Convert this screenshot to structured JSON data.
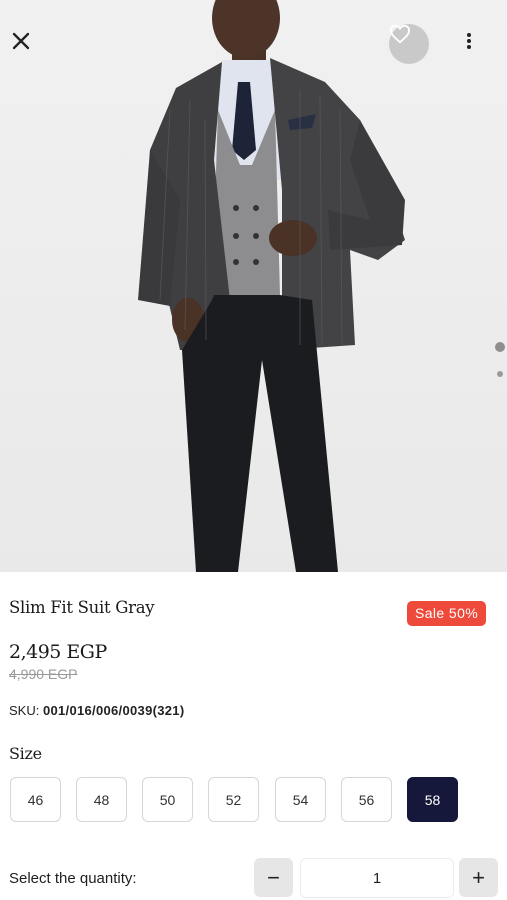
{
  "product": {
    "title": "Slim Fit Suit Gray",
    "badge": "Sale 50%",
    "price": "2,495 EGP",
    "old_price": "4,990 EGP",
    "sku_label": "SKU:",
    "sku_value": "001/016/006/0039(321)"
  },
  "header": {
    "close_icon": "close-icon",
    "favorite_icon": "heart-icon",
    "more_icon": "more-vertical-icon"
  },
  "gallery": {
    "image_count": 2,
    "active_index": 0
  },
  "size": {
    "heading": "Size",
    "options": [
      "46",
      "48",
      "50",
      "52",
      "54",
      "56",
      "58"
    ],
    "selected": "58"
  },
  "quantity": {
    "label": "Select the quantity:",
    "value": "1",
    "minus": "−",
    "plus": "+"
  },
  "colors": {
    "sale_badge": "#ee4a3c",
    "selected_size": "#15183a"
  }
}
